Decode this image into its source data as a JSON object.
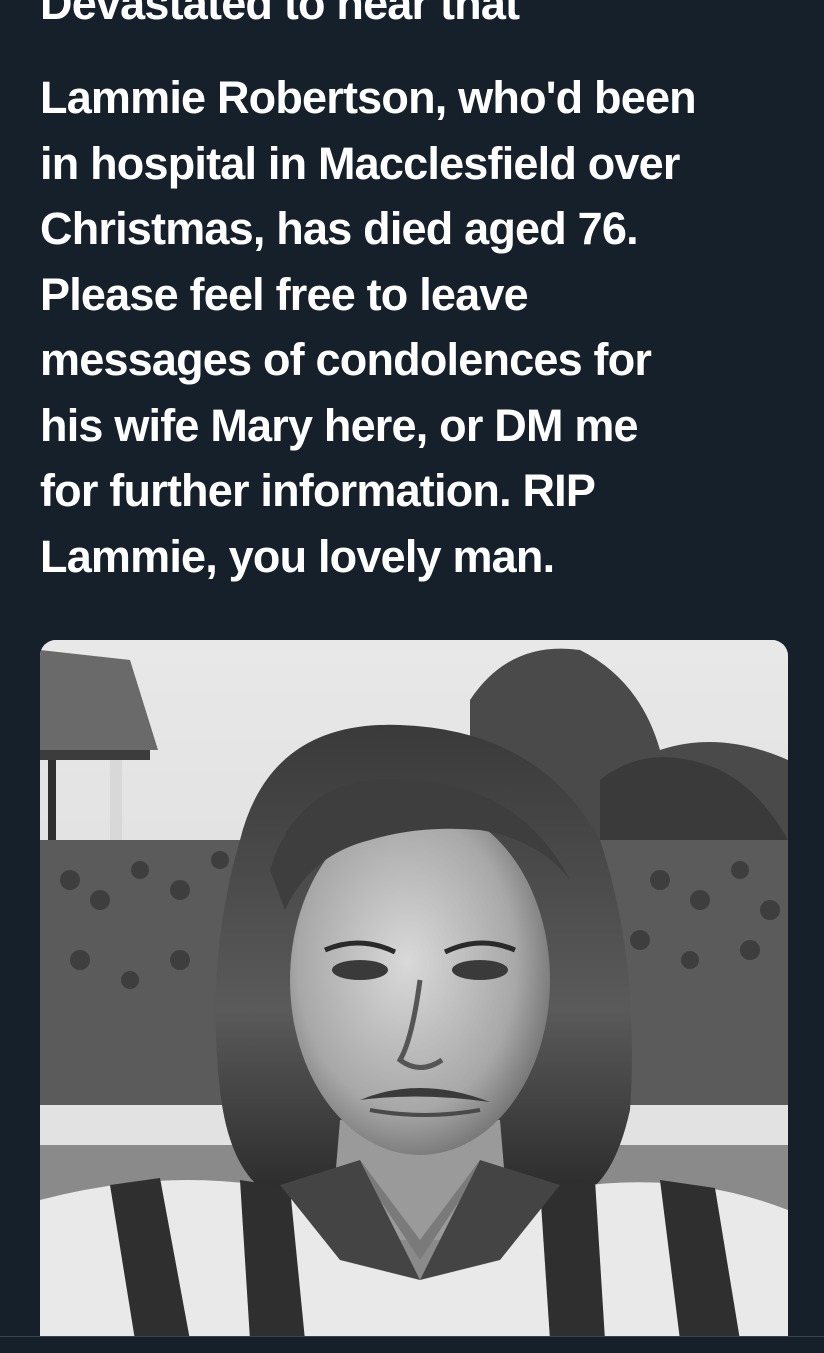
{
  "tweet": {
    "lines": [
      "Devastated to hear that",
      "Lammie Robertson, who'd been",
      "in hospital in Macclesfield over",
      "Christmas, has died aged 76.",
      "Please feel free to leave",
      "messages of condolences for",
      "his wife Mary here, or DM me",
      "for further information. RIP",
      "Lammie, you lovely man."
    ]
  },
  "media": {
    "description_icon": "photo-icon"
  },
  "colors": {
    "background": "#15202b",
    "text": "#ffffff"
  }
}
